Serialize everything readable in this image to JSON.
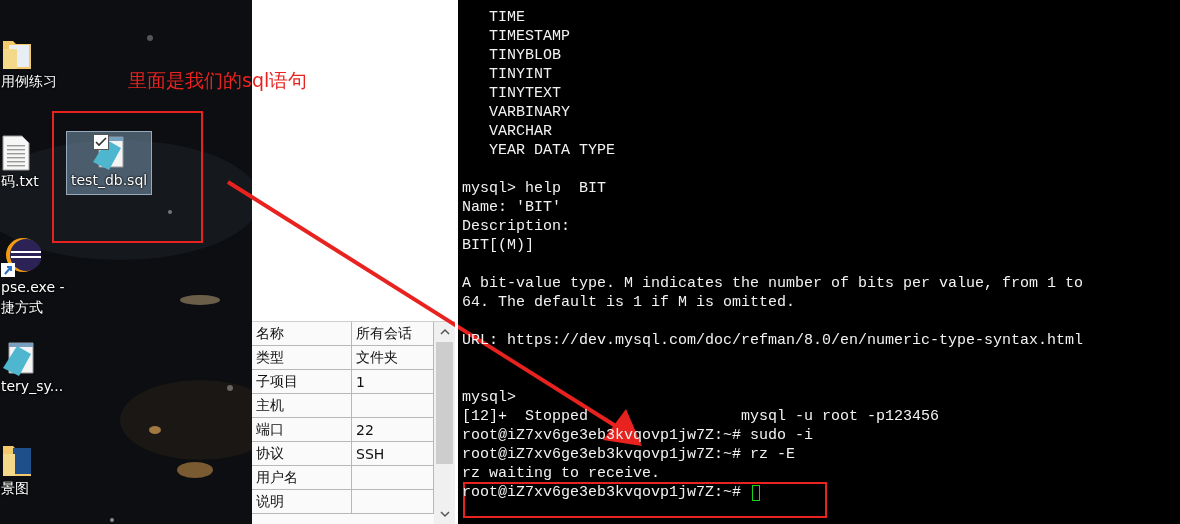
{
  "annotation": {
    "note": "里面是我们的sql语句"
  },
  "desktop": {
    "icons": [
      {
        "kind": "folder",
        "label": "用例练习",
        "selected": false
      },
      {
        "kind": "text-file",
        "label": "码.txt",
        "selected": false
      },
      {
        "kind": "shortcut",
        "label": "pse.exe -\n捷方式",
        "selected": false
      },
      {
        "kind": "notepad",
        "label": "tery_sy...",
        "selected": false
      },
      {
        "kind": "image-folder",
        "label": "景图",
        "selected": false
      },
      {
        "kind": "notepad",
        "label": "test_db.sql",
        "selected": true
      }
    ]
  },
  "properties": {
    "rows": [
      {
        "name": "名称",
        "value": "所有会话"
      },
      {
        "name": "类型",
        "value": "文件夹"
      },
      {
        "name": "子项目",
        "value": "1"
      },
      {
        "name": "主机"
      },
      {
        "name": "端口",
        "value": "22"
      },
      {
        "name": "协议",
        "value": "SSH"
      },
      {
        "name": "用户名"
      },
      {
        "name": "说明"
      }
    ]
  },
  "terminal": {
    "lines": [
      {
        "kind": "text",
        "text": "   TIME"
      },
      {
        "kind": "text",
        "text": "   TIMESTAMP"
      },
      {
        "kind": "text",
        "text": "   TINYBLOB"
      },
      {
        "kind": "text",
        "text": "   TINYINT"
      },
      {
        "kind": "text",
        "text": "   TINYTEXT"
      },
      {
        "kind": "text",
        "text": "   VARBINARY"
      },
      {
        "kind": "text",
        "text": "   VARCHAR"
      },
      {
        "kind": "text",
        "text": "   YEAR DATA TYPE"
      },
      {
        "kind": "blank"
      },
      {
        "kind": "text",
        "text": "mysql> help  BIT"
      },
      {
        "kind": "text",
        "text": "Name: 'BIT'"
      },
      {
        "kind": "text",
        "text": "Description:"
      },
      {
        "kind": "text",
        "text": "BIT[(M)]"
      },
      {
        "kind": "blank"
      },
      {
        "kind": "text",
        "text": "A bit-value type. M indicates the number of bits per value, from 1 to"
      },
      {
        "kind": "text",
        "text": "64. The default is 1 if M is omitted."
      },
      {
        "kind": "blank"
      },
      {
        "kind": "text",
        "text": "URL: https://dev.mysql.com/doc/refman/8.0/en/numeric-type-syntax.html"
      },
      {
        "kind": "blank"
      },
      {
        "kind": "blank"
      },
      {
        "kind": "text",
        "text": "mysql>"
      },
      {
        "kind": "text",
        "text": "[12]+  Stopped                 mysql -u root -p123456"
      },
      {
        "kind": "text",
        "text": "root@iZ7xv6ge3eb3kvqovp1jw7Z:~# sudo -i"
      },
      {
        "kind": "text",
        "text": "root@iZ7xv6ge3eb3kvqovp1jw7Z:~# rz -E"
      },
      {
        "kind": "text",
        "text": "rz waiting to receive."
      },
      {
        "kind": "prompt",
        "text": "root@iZ7xv6ge3eb3kvqovp1jw7Z:~# ",
        "cursor": true
      }
    ]
  }
}
